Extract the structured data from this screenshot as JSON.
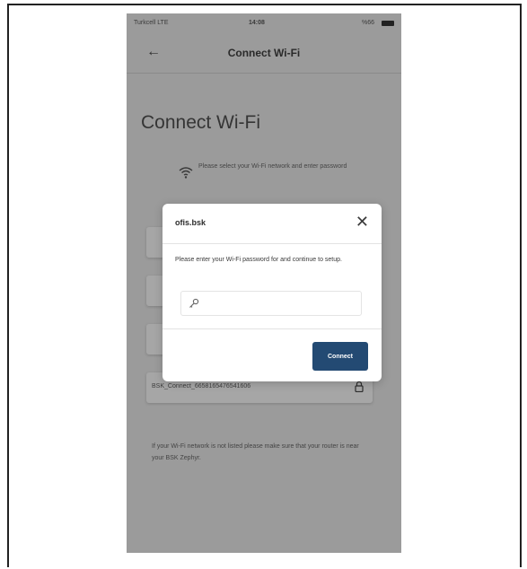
{
  "colors": {
    "phone_background": "#9b9b9b",
    "card_background": "#a6a6a6",
    "modal_background": "#ffffff",
    "button_primary": "#234a73"
  },
  "status_bar": {
    "carrier": "Turkcell LTE",
    "time": "14:08",
    "battery": "%66"
  },
  "header": {
    "back_icon": "arrow-left-icon",
    "title": "Connect Wi-Fi"
  },
  "main": {
    "page_title": "Connect Wi-Fi",
    "hint_icon": "wifi-icon",
    "hint": "Please select your Wi-Fi network and enter password",
    "networks": [
      {
        "label": ""
      },
      {
        "label": ""
      },
      {
        "label": ""
      },
      {
        "label": "BSK_Connect_6658165476541606"
      }
    ],
    "lock_icon": "lock-icon",
    "footer": "If your Wi-Fi network is not listed please make sure that your router is near your BSK Zephyr."
  },
  "modal": {
    "title": "ofis.bsk",
    "close_icon": "close-icon",
    "message": "Please enter your Wi-Fi password for and continue to setup.",
    "password_value": "",
    "password_placeholder": "",
    "key_icon": "key-icon",
    "connect_label": "Connect"
  }
}
